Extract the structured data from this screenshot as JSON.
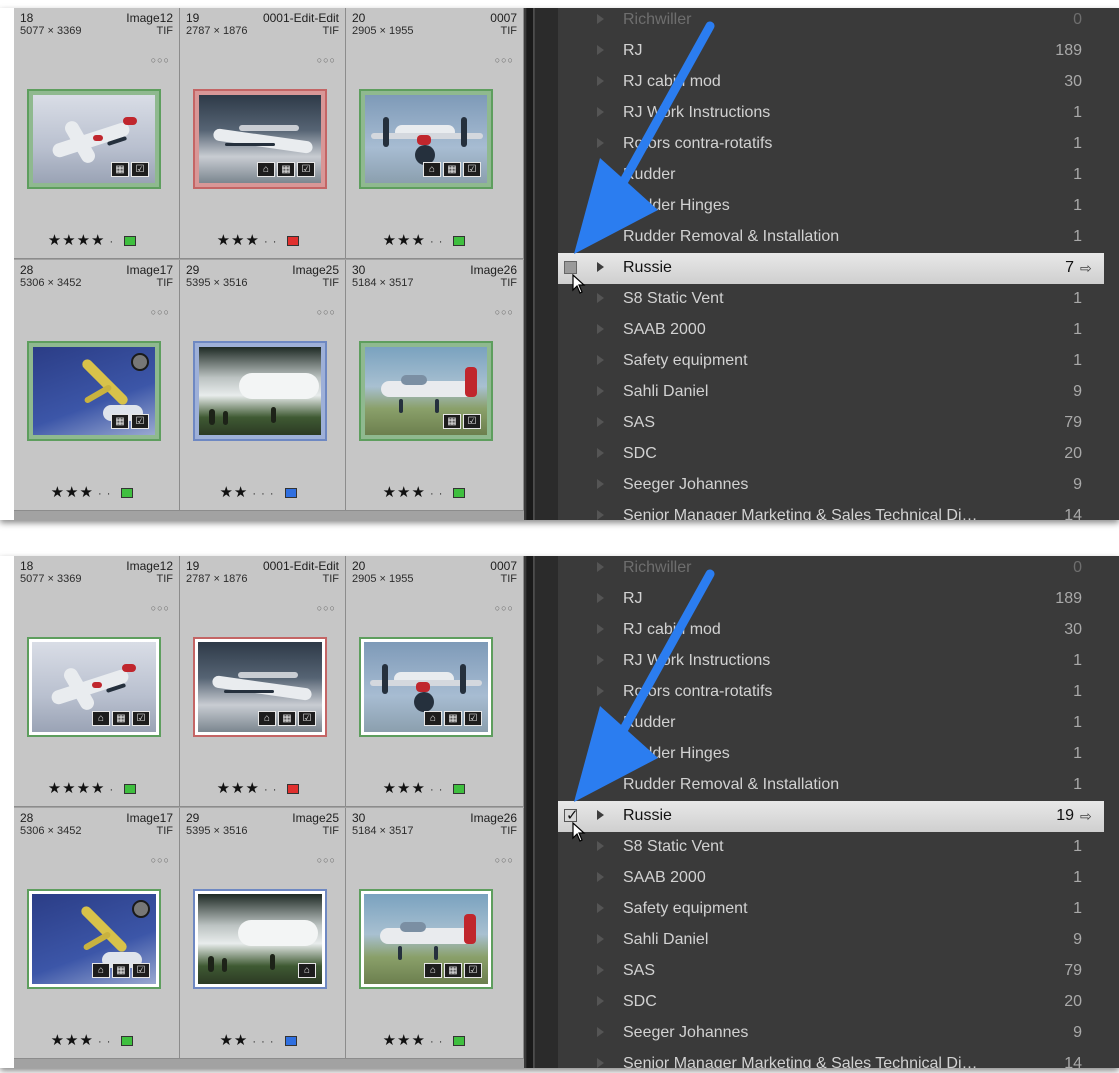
{
  "panels": [
    {
      "id": "before",
      "cells": [
        {
          "num": "18",
          "fname": "Image12",
          "dims": "5077 × 3369",
          "ftype": "TIF",
          "more": "○○○",
          "stars": "★★★★",
          "dots": "·",
          "label_color": "#3fbf3f",
          "frame": "green",
          "img": "sky-white",
          "badges": [
            "▦",
            "☑"
          ]
        },
        {
          "num": "19",
          "fname": "0001-Edit-Edit",
          "dims": "2787 × 1876",
          "ftype": "TIF",
          "more": "○○○",
          "stars": "★★★",
          "dots": "· ·",
          "label_color": "#e0302e",
          "frame": "red",
          "img": "water",
          "badges": [
            "⌂",
            "▦",
            "☑"
          ]
        },
        {
          "num": "20",
          "fname": "0007",
          "dims": "2905 × 1955",
          "ftype": "TIF",
          "more": "○○○",
          "stars": "★★★",
          "dots": "· ·",
          "label_color": "#3fbf3f",
          "frame": "green",
          "img": "sky-blue",
          "badges": [
            "⌂",
            "▦",
            "☑"
          ]
        },
        {
          "num": "28",
          "fname": "Image17",
          "dims": "5306 × 3452",
          "ftype": "TIF",
          "more": "○○○",
          "stars": "★★★",
          "dots": "· ·",
          "label_color": "#3fbf3f",
          "frame": "green",
          "img": "deep-blue",
          "badges": [
            "▦",
            "☑"
          ]
        },
        {
          "num": "29",
          "fname": "Image25",
          "dims": "5395 × 3516",
          "ftype": "TIF",
          "more": "○○○",
          "stars": "★★",
          "dots": "· · ·",
          "label_color": "#2f6fe0",
          "frame": "blue",
          "img": "smoke",
          "badges": []
        },
        {
          "num": "30",
          "fname": "Image26",
          "dims": "5184 × 3517",
          "ftype": "TIF",
          "more": "○○○",
          "stars": "★★★",
          "dots": "· ·",
          "label_color": "#3fbf3f",
          "frame": "green",
          "img": "field",
          "badges": [
            "▦",
            "☑"
          ]
        }
      ],
      "selected_count": "7"
    },
    {
      "id": "after",
      "cells": [
        {
          "num": "18",
          "fname": "Image12",
          "dims": "5077 × 3369",
          "ftype": "TIF",
          "more": "○○○",
          "stars": "★★★★",
          "dots": "·",
          "label_color": "#3fbf3f",
          "frame": "green",
          "img": "sky-white",
          "badges": [
            "⌂",
            "▦",
            "☑"
          ]
        },
        {
          "num": "19",
          "fname": "0001-Edit-Edit",
          "dims": "2787 × 1876",
          "ftype": "TIF",
          "more": "○○○",
          "stars": "★★★",
          "dots": "· ·",
          "label_color": "#e0302e",
          "frame": "red",
          "img": "water",
          "badges": [
            "⌂",
            "▦",
            "☑"
          ]
        },
        {
          "num": "20",
          "fname": "0007",
          "dims": "2905 × 1955",
          "ftype": "TIF",
          "more": "○○○",
          "stars": "★★★",
          "dots": "· ·",
          "label_color": "#3fbf3f",
          "frame": "green",
          "img": "sky-blue",
          "badges": [
            "⌂",
            "▦",
            "☑"
          ]
        },
        {
          "num": "28",
          "fname": "Image17",
          "dims": "5306 × 3452",
          "ftype": "TIF",
          "more": "○○○",
          "stars": "★★★",
          "dots": "· ·",
          "label_color": "#3fbf3f",
          "frame": "green",
          "img": "deep-blue",
          "badges": [
            "⌂",
            "▦",
            "☑"
          ]
        },
        {
          "num": "29",
          "fname": "Image25",
          "dims": "5395 × 3516",
          "ftype": "TIF",
          "more": "○○○",
          "stars": "★★",
          "dots": "· · ·",
          "label_color": "#2f6fe0",
          "frame": "blue",
          "img": "smoke",
          "badges": [
            "⌂"
          ]
        },
        {
          "num": "30",
          "fname": "Image26",
          "dims": "5184 × 3517",
          "ftype": "TIF",
          "more": "○○○",
          "stars": "★★★",
          "dots": "· ·",
          "label_color": "#3fbf3f",
          "frame": "green",
          "img": "field",
          "badges": [
            "⌂",
            "▦",
            "☑"
          ]
        }
      ],
      "selected_count": "19"
    }
  ],
  "keywords": [
    {
      "name": "Richwiller",
      "count": "0",
      "faded": true
    },
    {
      "name": "RJ",
      "count": "189"
    },
    {
      "name": "RJ cabin mod",
      "count": "30"
    },
    {
      "name": "RJ Work Instructions",
      "count": "1"
    },
    {
      "name": "Rotors contra-rotatifs",
      "count": "1"
    },
    {
      "name": "Rudder",
      "count": "1"
    },
    {
      "name": "Rudder Hinges",
      "count": "1"
    },
    {
      "name": "Rudder Removal & Installation",
      "count": "1"
    },
    {
      "name": "Russie",
      "count": "",
      "selected": true
    },
    {
      "name": "S8 Static Vent",
      "count": "1"
    },
    {
      "name": "SAAB 2000",
      "count": "1"
    },
    {
      "name": "Safety equipment",
      "count": "1"
    },
    {
      "name": "Sahli Daniel",
      "count": "9"
    },
    {
      "name": "SAS",
      "count": "79"
    },
    {
      "name": "SDC",
      "count": "20"
    },
    {
      "name": "Seeger Johannes",
      "count": "9"
    },
    {
      "name": "Senior Manager Marketing & Sales Technical Di…",
      "count": "14"
    }
  ],
  "icons": {
    "row_arrow": "arrow-right-icon",
    "expand": "disclosure-triangle-icon",
    "cursor": "mouse-pointer-icon",
    "annotation": "blue-arrow-annotation"
  },
  "colors": {
    "annotation_blue": "#2b7df0",
    "label_green": "#3fbf3f",
    "label_red": "#e0302e",
    "label_blue": "#2f6fe0"
  }
}
